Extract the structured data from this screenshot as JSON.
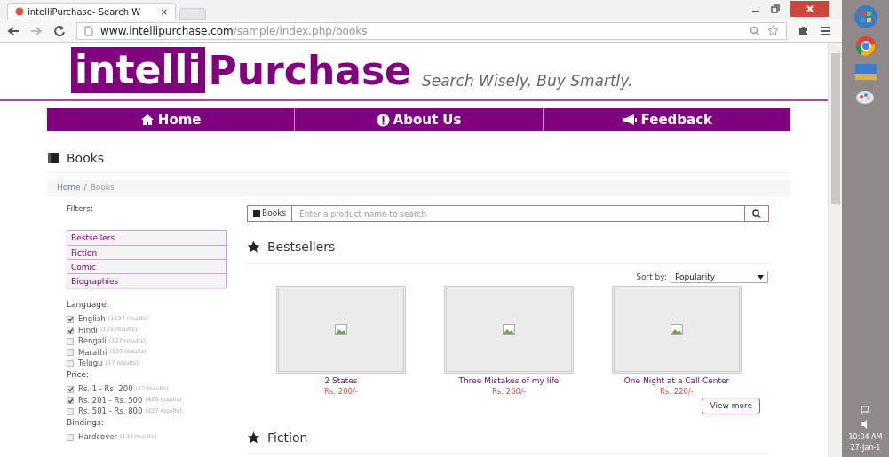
{
  "browser": {
    "tab_title": "intelliPurchase- Search W",
    "close_glyph": "×",
    "url_host": "www.intellipurchase.com",
    "url_path": "/sample/index.php/books"
  },
  "site": {
    "logo_a": "intelli",
    "logo_b": "Purchase",
    "tagline": "Search Wisely, Buy Smartly.",
    "nav": [
      {
        "kind": "home",
        "label": "Home"
      },
      {
        "kind": "info",
        "label": "About Us"
      },
      {
        "kind": "megaphone",
        "label": "Feedback"
      }
    ]
  },
  "page_title": "Books",
  "breadcrumb": [
    "Home",
    "/",
    "Books"
  ],
  "filters": {
    "label": "Filters:",
    "categories": [
      "Bestsellers",
      "Fiction",
      "Comic",
      "Biographies"
    ],
    "groups": [
      {
        "title": "Language:",
        "options": [
          {
            "label": "English",
            "count": "(1237 results)",
            "checked": true
          },
          {
            "label": "Hindi",
            "count": "(125 results)",
            "checked": true
          },
          {
            "label": "Bengali",
            "count": "(127 results)",
            "checked": false
          },
          {
            "label": "Marathi",
            "count": "(157 results)",
            "checked": false
          },
          {
            "label": "Telugu",
            "count": "(17 results)",
            "checked": false
          }
        ]
      },
      {
        "title": "Price:",
        "options": [
          {
            "label": "Rs. 1 - Rs. 200",
            "count": "(12 results)",
            "checked": true
          },
          {
            "label": "Rs. 201 - Rs. 500",
            "count": "(425 results)",
            "checked": true
          },
          {
            "label": "Rs. 501 - Rs. 800",
            "count": "(327 results)",
            "checked": false
          }
        ]
      },
      {
        "title": "Bindings:",
        "options": [
          {
            "label": "Hardcover",
            "count": "(133 results)",
            "checked": false
          }
        ]
      }
    ]
  },
  "search": {
    "scope": "Books",
    "placeholder": "Enter a product name to search"
  },
  "section": {
    "title": "Bestsellers",
    "sort_label": "Sort by:",
    "sort_value": "Popularity",
    "products": [
      {
        "title": "2 States",
        "price": "Rs. 200/-"
      },
      {
        "title": "Three Mistakes of my life",
        "price": "Rs. 260/-"
      },
      {
        "title": "One Night at a Call Center",
        "price": "Rs. 220/-"
      }
    ],
    "view_more": "View more"
  },
  "next_section": {
    "title": "Fiction"
  },
  "taskbar": {
    "time": "10:04 AM",
    "date": "27-Jan-1"
  }
}
